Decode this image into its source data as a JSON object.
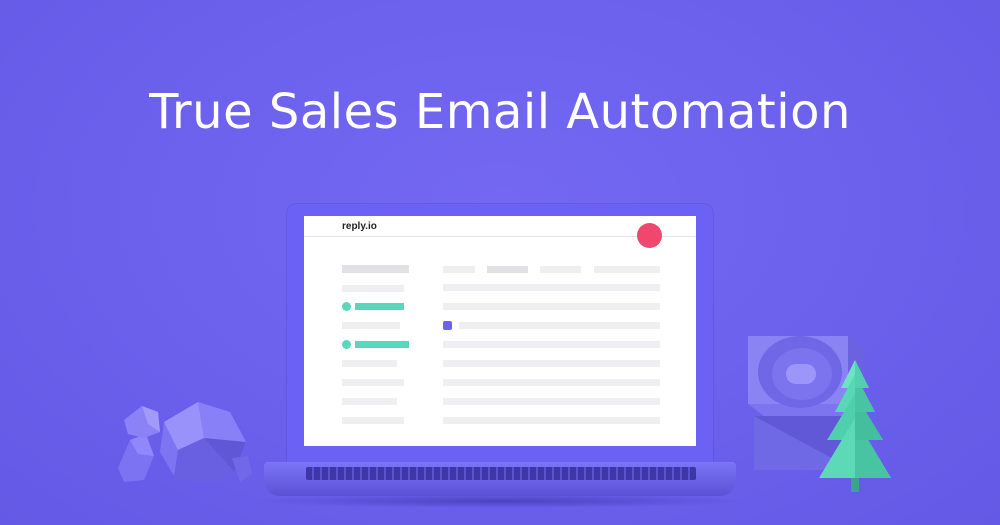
{
  "headline": "True Sales Email Automation",
  "app": {
    "logo": "reply.io"
  },
  "colors": {
    "background": "#6c62ee",
    "accent": "#58d7bc",
    "avatar": "#f0476f",
    "checkbox": "#6c62ee"
  },
  "icons": {
    "avatar": "avatar-circle",
    "checkbox": "checkbox-checked",
    "decor_left": "polyhedron-crystal",
    "decor_right_block": "carved-block",
    "decor_tree": "pine-tree"
  }
}
